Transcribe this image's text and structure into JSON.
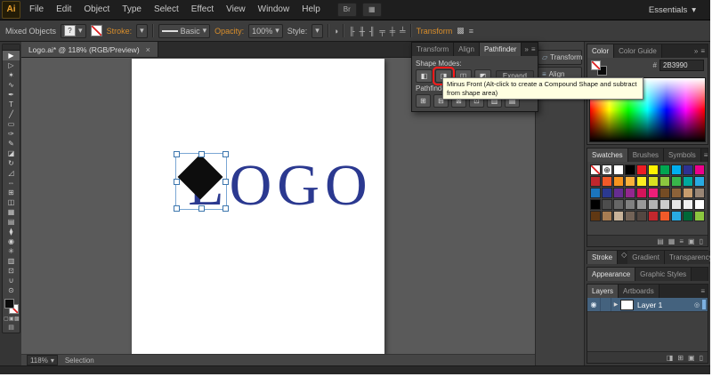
{
  "app": {
    "logo_text": "Ai",
    "workspace": "Essentials"
  },
  "colors": {
    "logo_blue": "#2b3990",
    "highlight_red": "#ff0000",
    "selection_blue": "#7aa7d4",
    "accent_orange": "#d98e2b"
  },
  "icons": {
    "caret_down": "▾",
    "caret_right": "▶",
    "double_arrow": "»",
    "panel_menu": "≡",
    "close": "×",
    "bridge": "Br",
    "arrange": "▦",
    "registration": "⊕",
    "eye": "◉",
    "target": "◎",
    "recolor": "◑",
    "gradient_chip": "◇",
    "draw_normal": "▢",
    "draw_behind": "▣",
    "draw_inside": "▩",
    "screen_mode": "▤",
    "clip_mask": "◨",
    "new_sublayer": "⊞",
    "new_layer": "▣",
    "delete": "▯",
    "libraries": "▤",
    "color_group": "▦",
    "list": "≡",
    "new_swatch": "▣"
  },
  "menubar": {
    "items": [
      "File",
      "Edit",
      "Object",
      "Type",
      "Select",
      "Effect",
      "View",
      "Window",
      "Help"
    ]
  },
  "controlbar": {
    "selection_type": "Mixed Objects",
    "fill_indicator": "?",
    "stroke_link": "Stroke:",
    "brush_definition": "Basic",
    "opacity_link": "Opacity:",
    "opacity_value": "100%",
    "style_label": "Style:",
    "transform_link": "Transform",
    "align_icons": [
      "╟",
      "╫",
      "╢",
      "╤",
      "╪",
      "╧"
    ]
  },
  "toolbar": {
    "tools": [
      {
        "name": "selection-tool",
        "glyph": "▶",
        "active": true
      },
      {
        "name": "direct-selection-tool",
        "glyph": "▷"
      },
      {
        "name": "magic-wand-tool",
        "glyph": "✶"
      },
      {
        "name": "lasso-tool",
        "glyph": "∿"
      },
      {
        "name": "pen-tool",
        "glyph": "✒"
      },
      {
        "name": "type-tool",
        "glyph": "T"
      },
      {
        "name": "line-segment-tool",
        "glyph": "╱"
      },
      {
        "name": "rectangle-tool",
        "glyph": "▭"
      },
      {
        "name": "paintbrush-tool",
        "glyph": "✑"
      },
      {
        "name": "pencil-tool",
        "glyph": "✎"
      },
      {
        "name": "eraser-tool",
        "glyph": "◪"
      },
      {
        "name": "rotate-tool",
        "glyph": "↻"
      },
      {
        "name": "scale-tool",
        "glyph": "◿"
      },
      {
        "name": "width-tool",
        "glyph": "⇔"
      },
      {
        "name": "free-transform-tool",
        "glyph": "⊞"
      },
      {
        "name": "shape-builder-tool",
        "glyph": "◫"
      },
      {
        "name": "mesh-tool",
        "glyph": "▦"
      },
      {
        "name": "gradient-tool",
        "glyph": "▤"
      },
      {
        "name": "eyedropper-tool",
        "glyph": "⧫"
      },
      {
        "name": "blend-tool",
        "glyph": "◉"
      },
      {
        "name": "symbol-sprayer-tool",
        "glyph": "✳"
      },
      {
        "name": "column-graph-tool",
        "glyph": "▥"
      },
      {
        "name": "artboard-tool",
        "glyph": "⊡"
      },
      {
        "name": "hand-tool",
        "glyph": "∪"
      },
      {
        "name": "zoom-tool",
        "glyph": "⊙"
      }
    ]
  },
  "document": {
    "tab_title": "Logo.ai* @ 118% (RGB/Preview)",
    "artboard_word": "LOGO",
    "status": {
      "zoom": "118%",
      "tool": "Selection"
    }
  },
  "pathfinder_panel": {
    "tabs": [
      "Transform",
      "Align",
      "Pathfinder"
    ],
    "shape_modes_label": "Shape Modes:",
    "shape_modes": [
      {
        "name": "unite",
        "glyph": "◧"
      },
      {
        "name": "minus-front",
        "glyph": "◨",
        "highlighted": true
      },
      {
        "name": "intersect",
        "glyph": "◫"
      },
      {
        "name": "exclude",
        "glyph": "◩"
      }
    ],
    "expand_label": "Expand",
    "pathfinders_label": "Pathfinders:",
    "pathfinders": [
      {
        "name": "divide",
        "glyph": "⊞"
      },
      {
        "name": "trim",
        "glyph": "⊟"
      },
      {
        "name": "merge",
        "glyph": "⊠"
      },
      {
        "name": "crop",
        "glyph": "⊡"
      },
      {
        "name": "outline",
        "glyph": "▥"
      },
      {
        "name": "minus-back",
        "glyph": "▤"
      }
    ],
    "tooltip": "Minus Front (Alt-click to create a Compound Shape and subtract from shape area)"
  },
  "collapsed_dock": {
    "buttons": [
      {
        "label": "Transform",
        "glyph": "▱"
      },
      {
        "label": "Align",
        "glyph": "≡"
      }
    ]
  },
  "color_panel": {
    "tabs": [
      "Color",
      "Color Guide"
    ],
    "hex_label": "#",
    "hex_value": "2B3990"
  },
  "swatches_panel": {
    "tabs": [
      "Swatches",
      "Brushes",
      "Symbols"
    ],
    "rows": [
      [
        "none",
        "registration",
        "#ffffff",
        "#000000",
        "#ed1c24",
        "#fff200",
        "#00a651",
        "#00aeef",
        "#2e3192",
        "#ec008c"
      ],
      [
        "#c1272d",
        "#f15a29",
        "#f7941e",
        "#fbb03b",
        "#fcee21",
        "#d9e021",
        "#8cc63f",
        "#39b54a",
        "#00a99d",
        "#29abe2"
      ],
      [
        "#1b75bc",
        "#2b3990",
        "#662d91",
        "#93278f",
        "#d4145a",
        "#ed1e79",
        "#754c24",
        "#8c6239",
        "#c69c6d",
        "#998675"
      ],
      [
        "#000000",
        "#4d4d4d",
        "#666666",
        "#808080",
        "#999999",
        "#b3b3b3",
        "#cccccc",
        "#e6e6e6",
        "#f2f2f2",
        "#ffffff"
      ],
      [
        "#603813",
        "#a67c52",
        "#c7b299",
        "#736357",
        "#534741",
        "#c1272d",
        "#f15a29",
        "#29abe2",
        "#006837",
        "#8cc63f"
      ]
    ]
  },
  "stroke_panel": {
    "tabs": [
      "Stroke",
      "Gradient",
      "Transparency"
    ]
  },
  "appearance_panel": {
    "tabs": [
      "Appearance",
      "Graphic Styles"
    ]
  },
  "layers_panel": {
    "tabs": [
      "Layers",
      "Artboards"
    ],
    "layer_name": "Layer 1"
  }
}
